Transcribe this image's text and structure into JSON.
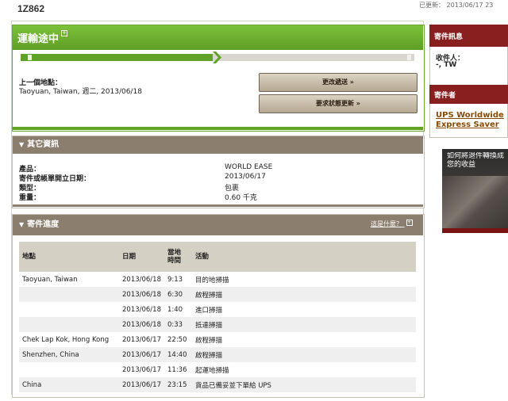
{
  "header": {
    "tracking_number": "1Z862",
    "updated": "已更新： 2013/06/17 23"
  },
  "status": {
    "title": "運輸途中",
    "info_icon": "info-square-icon",
    "progress_fraction": 0.5,
    "last_location_label": "上一個地點：",
    "last_location_value": "Taoyuan, Taiwan, 週二, 2013/06/18",
    "change_delivery_button": "更改遞送 »",
    "request_update_button": "要求狀態更新 »"
  },
  "other_info": {
    "title": "其它資訊",
    "rows": [
      {
        "label": "產品：",
        "value": "WORLD EASE"
      },
      {
        "label": "寄件或帳單開立日期：",
        "value": "2013/06/17"
      },
      {
        "label": "類型：",
        "value": "包裹"
      },
      {
        "label": "重量：",
        "value": "0.60 千克"
      }
    ]
  },
  "progress": {
    "title": "寄件進度",
    "what_is_this": "這是什麼？",
    "headers": {
      "location": "地點",
      "date": "日期",
      "time": "當地 時間",
      "activity": "活動"
    },
    "rows": [
      {
        "location": "Taoyuan, Taiwan",
        "date": "2013/06/18",
        "time": "9:13",
        "activity": "目的地掃描"
      },
      {
        "location": "",
        "date": "2013/06/18",
        "time": "6:30",
        "activity": "啟程掃描"
      },
      {
        "location": "",
        "date": "2013/06/18",
        "time": "1:40",
        "activity": "進口掃描"
      },
      {
        "location": "",
        "date": "2013/06/18",
        "time": "0:33",
        "activity": "抵達掃描"
      },
      {
        "location": "Chek Lap Kok, Hong Kong",
        "date": "2013/06/17",
        "time": "22:50",
        "activity": "啟程掃描"
      },
      {
        "location": "Shenzhen, China",
        "date": "2013/06/17",
        "time": "14:40",
        "activity": "啟程掃描"
      },
      {
        "location": "",
        "date": "2013/06/17",
        "time": "11:36",
        "activity": "起運地掃描"
      },
      {
        "location": "China",
        "date": "2013/06/17",
        "time": "23:15",
        "activity": "貨品已備妥並下單給 UPS"
      }
    ]
  },
  "sidebar": {
    "shipment_info_title": "寄件訊息",
    "recipient_label": "收件人：",
    "recipient_value": "-, TW",
    "shipper_title": "寄件者",
    "service_link": "UPS Worldwide Express Saver",
    "ad_text": "如何將退件轉換成您的收益"
  },
  "colors": {
    "status_green": "#5fa326",
    "section_brown": "#8c7e6e",
    "side_red": "#8a1f1f"
  }
}
